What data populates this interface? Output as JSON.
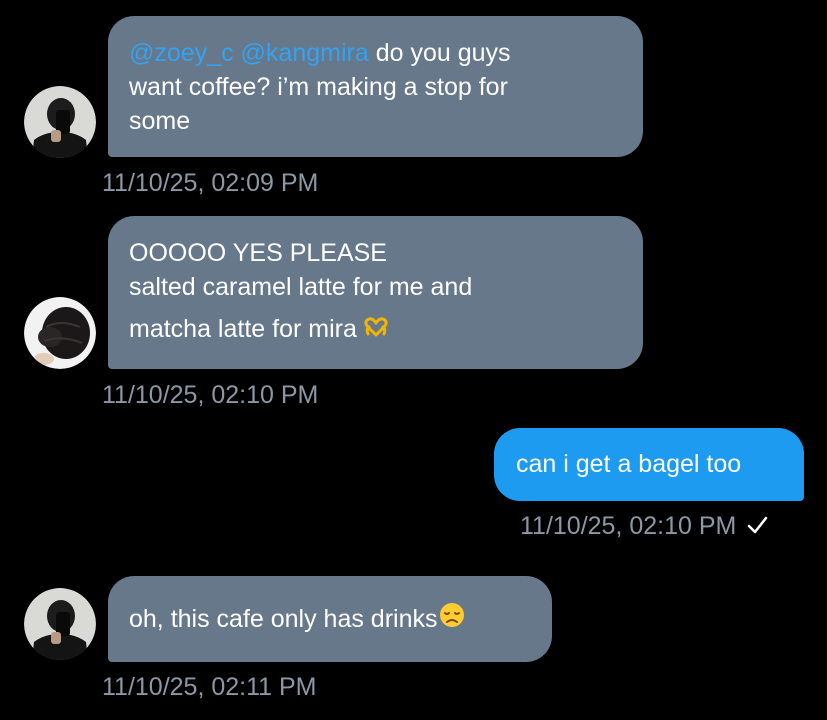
{
  "messages": [
    {
      "direction": "incoming",
      "avatar": "user-avatar-photo",
      "mentions": [
        "@zoey_c",
        "@kangmira"
      ],
      "line1_text": " do you guys",
      "line2": "want coffee? i’m making a stop for",
      "line3": "some",
      "timestamp": "11/10/25, 02:09 PM"
    },
    {
      "direction": "incoming",
      "avatar": "user-avatar-photo",
      "line1": "OOOOO YES PLEASE",
      "line2": "salted caramel latte for me and",
      "line3": "matcha latte for mira",
      "emoji": "heart-hands-emoji",
      "timestamp": "11/10/25, 02:10 PM"
    },
    {
      "direction": "outgoing",
      "text": "can i get a bagel too",
      "timestamp": "11/10/25, 02:10 PM",
      "status_icon": "checkmark-icon"
    },
    {
      "direction": "incoming",
      "avatar": "user-avatar-photo",
      "text": "oh, this cafe only has drinks",
      "emoji": "disappointed-face-emoji",
      "timestamp": "11/10/25, 02:11 PM"
    }
  ],
  "colors": {
    "background": "#000000",
    "incoming_bubble": "#66788a",
    "outgoing_bubble": "#1d9bf0",
    "mention": "#33a2f2",
    "timestamp": "#8b98a5",
    "text": "#ffffff"
  }
}
